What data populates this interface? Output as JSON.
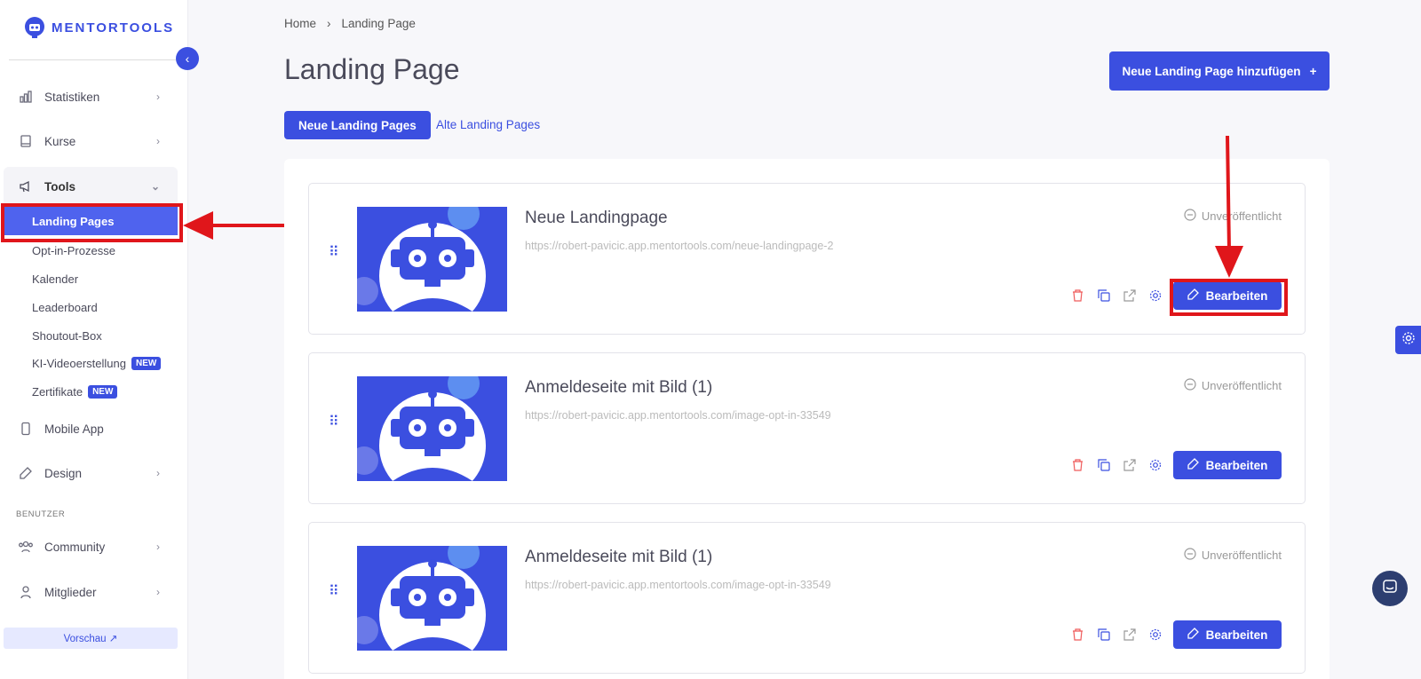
{
  "brand": {
    "name": "MENTORTOOLS",
    "accent": "#3b4fe0",
    "highlight": "#e0161b"
  },
  "sidebar": {
    "items": [
      {
        "label": "Statistiken",
        "icon": "bar-chart-icon"
      },
      {
        "label": "Kurse",
        "icon": "book-icon"
      },
      {
        "label": "Tools",
        "icon": "megaphone-icon"
      }
    ],
    "tools_sub": [
      {
        "label": "Landing Pages"
      },
      {
        "label": "Opt-in-Prozesse"
      },
      {
        "label": "Kalender"
      },
      {
        "label": "Leaderboard"
      },
      {
        "label": "Shoutout-Box"
      },
      {
        "label": "KI-Videoerstellung",
        "badge": "NEW"
      },
      {
        "label": "Zertifikate",
        "badge": "NEW"
      }
    ],
    "mobile_app": "Mobile App",
    "design": "Design",
    "section_label": "BENUTZER",
    "community": "Community",
    "mitglieder": "Mitglieder",
    "preview": "Vorschau ↗"
  },
  "breadcrumb": {
    "home": "Home",
    "current": "Landing Page"
  },
  "page": {
    "title": "Landing Page",
    "add_button": "Neue Landing Page hinzufügen",
    "tabs": [
      "Neue Landing Pages",
      "Alte Landing Pages"
    ]
  },
  "cards": [
    {
      "title": "Neue Landingpage",
      "url": "https://robert-pavicic.app.mentortools.com/neue-landingpage-2",
      "status": "Unveröffentlicht",
      "edit": "Bearbeiten"
    },
    {
      "title": "Anmeldeseite mit Bild (1)",
      "url": "https://robert-pavicic.app.mentortools.com/image-opt-in-33549",
      "status": "Unveröffentlicht",
      "edit": "Bearbeiten"
    },
    {
      "title": "Anmeldeseite mit Bild (1)",
      "url": "https://robert-pavicic.app.mentortools.com/image-opt-in-33549",
      "status": "Unveröffentlicht",
      "edit": "Bearbeiten"
    }
  ]
}
